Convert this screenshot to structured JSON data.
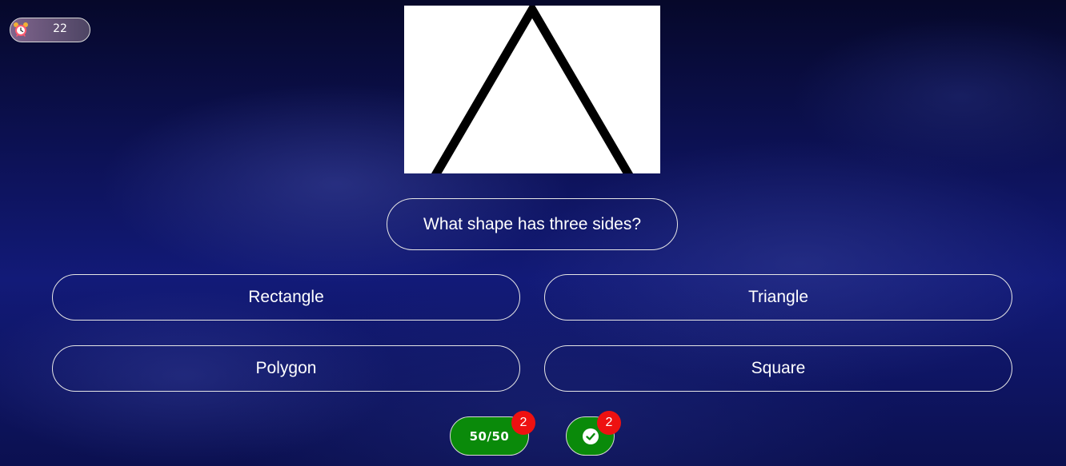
{
  "timer": {
    "icon": "alarm-clock-icon",
    "seconds_left": "22"
  },
  "question": {
    "image_icon": "triangle-image",
    "text": "What shape has three sides?"
  },
  "answers": [
    {
      "label": "Rectangle"
    },
    {
      "label": "Triangle"
    },
    {
      "label": "Polygon"
    },
    {
      "label": "Square"
    }
  ],
  "lifelines": {
    "fifty_fifty": {
      "label": "50/50",
      "count": "2"
    },
    "correct_answer": {
      "icon": "check-circle-icon",
      "count": "2"
    }
  },
  "colors": {
    "lifeline_green": "#0a8a0a",
    "badge_red": "#ee1111",
    "background_dark_blue": "#0d1258"
  }
}
